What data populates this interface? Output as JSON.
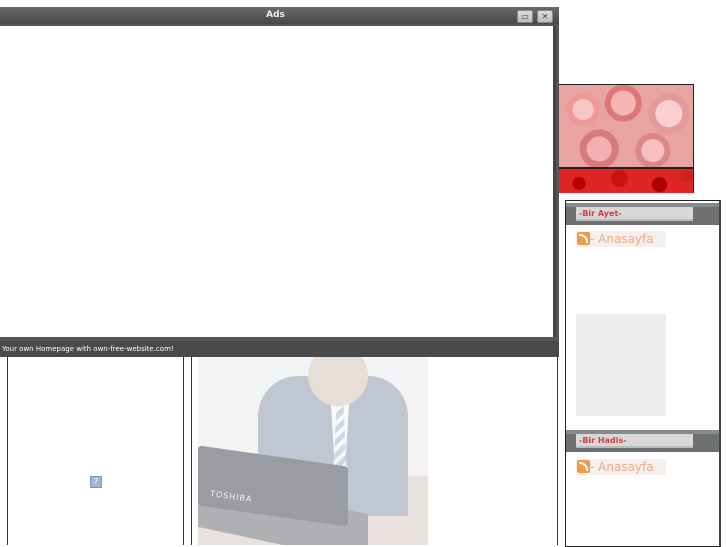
{
  "ads_window": {
    "title": "Ads",
    "footer_text": "Your own Homepage with own-free-website.com!",
    "buttons": {
      "restore": "▭",
      "close": "✕"
    }
  },
  "sidebar": {
    "sections": [
      {
        "label": "-Bir Ayet-",
        "feed_link": "- Anasayfa"
      },
      {
        "label": "-Bir Hadis-",
        "feed_link": "- Anasayfa"
      }
    ]
  },
  "misc": {
    "help_icon": "?",
    "photo_brand": "TOSHIBA"
  },
  "colors": {
    "section_label": "#d04040",
    "feed_link": "#f0a888",
    "titlebar": "#555555"
  }
}
